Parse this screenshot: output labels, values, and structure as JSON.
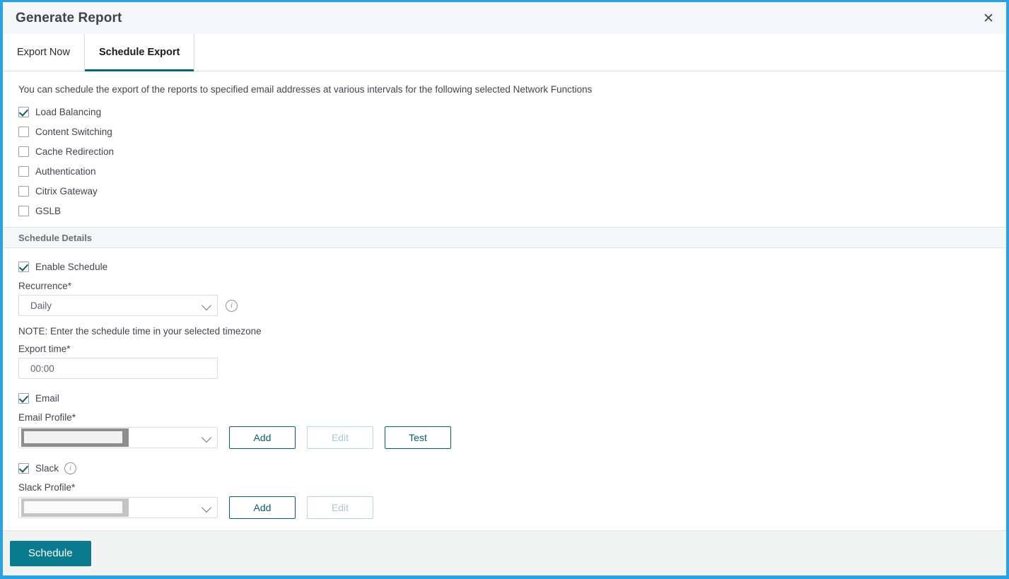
{
  "dialog": {
    "title": "Generate Report",
    "close_icon": "close-icon"
  },
  "tabs": [
    {
      "label": "Export Now",
      "active": false
    },
    {
      "label": "Schedule Export",
      "active": true
    }
  ],
  "body": {
    "intro": "You can schedule the export of the reports to specified email addresses at various intervals for the following selected Network Functions",
    "network_functions": [
      {
        "label": "Load Balancing",
        "checked": true
      },
      {
        "label": "Content Switching",
        "checked": false
      },
      {
        "label": "Cache Redirection",
        "checked": false
      },
      {
        "label": "Authentication",
        "checked": false
      },
      {
        "label": "Citrix Gateway",
        "checked": false
      },
      {
        "label": "GSLB",
        "checked": false
      }
    ]
  },
  "schedule_details": {
    "section_title": "Schedule Details",
    "enable_schedule": {
      "label": "Enable Schedule",
      "checked": true
    },
    "recurrence": {
      "label": "Recurrence*",
      "value": "Daily",
      "info_icon": "info-icon",
      "chevron_icon": "chevron-down-icon"
    },
    "note": "NOTE: Enter the schedule time in your selected timezone",
    "export_time": {
      "label": "Export time*",
      "value": "00:00",
      "placeholder": "00:00"
    },
    "email": {
      "label": "Email",
      "checked": true,
      "profile_label": "Email Profile*",
      "profile_value": "",
      "buttons": [
        {
          "label": "Add",
          "disabled": false
        },
        {
          "label": "Edit",
          "disabled": true
        },
        {
          "label": "Test",
          "disabled": false
        }
      ]
    },
    "slack": {
      "label": "Slack",
      "checked": true,
      "info_icon": "info-icon",
      "profile_label": "Slack Profile*",
      "profile_value": "",
      "buttons": [
        {
          "label": "Add",
          "disabled": false
        },
        {
          "label": "Edit",
          "disabled": true
        }
      ]
    }
  },
  "footer": {
    "submit_label": "Schedule"
  },
  "colors": {
    "dialog_border": "#29a3e3",
    "accent_tab_underline": "#046a7b",
    "primary_button": "#0b7c8f",
    "outline_button": "#0a5c6b",
    "checkbox_check": "#1a5a66",
    "titlebar_bg": "#f5f6f7",
    "section_bg": "#f5f6f7",
    "footer_bg": "#f1f2f2",
    "text": "#3f4650"
  }
}
